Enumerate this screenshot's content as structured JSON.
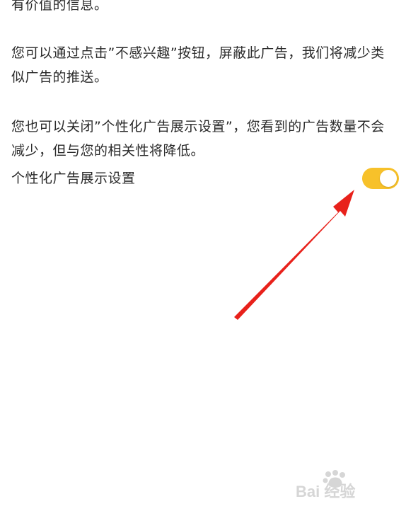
{
  "paragraphs": {
    "p1": "有价值的信息。",
    "p2": "您可以通过点击”不感兴趣”按钮，屏蔽此广告，我们将减少类似广告的推送。",
    "p3": "您也可以关闭”个性化广告展示设置”，您看到的广告数量不会减少，但与您的相关性将降低。"
  },
  "setting": {
    "label": "个性化广告展示设置",
    "enabled": true
  },
  "colors": {
    "toggle_on": "#F7C12A",
    "arrow": "#E8211B"
  },
  "watermark": {
    "text": "Bai 经验"
  }
}
